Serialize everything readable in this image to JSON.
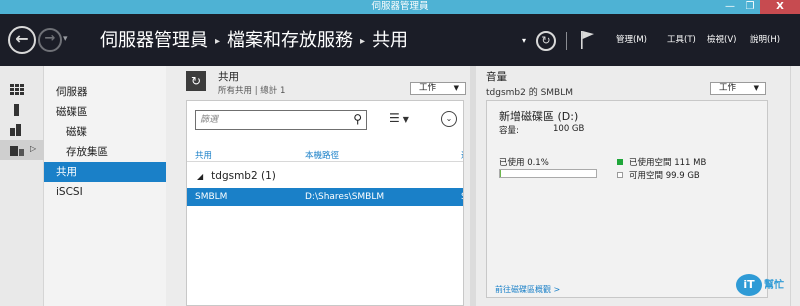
{
  "window": {
    "title": "伺服器管理員",
    "minimize_glyph": "—",
    "maximize_glyph": "❐",
    "close_glyph": "X"
  },
  "header": {
    "breadcrumb": [
      "伺服器管理員",
      "檔案和存放服務",
      "共用"
    ],
    "breadcrumb_sep": "▸",
    "menus": [
      "管理(M)",
      "工具(T)",
      "檢視(V)",
      "說明(H)"
    ],
    "back_glyph": "←",
    "forward_glyph": "→",
    "dropdown_glyph": "▾",
    "refresh_glyph": "↻"
  },
  "sidebar_icons": [
    "servers-icon",
    "server-icon",
    "volumes-icon",
    "storage-pools-icon"
  ],
  "nav": {
    "items": [
      "伺服器",
      "磁碟區",
      "磁碟",
      "存放集區",
      "共用",
      "iSCSI"
    ],
    "selected": "共用"
  },
  "shares_panel": {
    "title": "共用",
    "subtitle": "所有共用 | 總計 1",
    "tasks_label": "工作",
    "filter_placeholder": "篩選",
    "columns": [
      "共用",
      "本機路徑",
      "通"
    ],
    "group_label": "tdgsmb2 (1)",
    "rows": [
      {
        "share": "SMBLM",
        "path": "D:\\Shares\\SMBLM",
        "extra": "S"
      }
    ]
  },
  "volume_panel": {
    "title": "音量",
    "subtitle": "tdgsmb2 的 SMBLM",
    "tasks_label": "工作",
    "volume_name": "新增磁碟區 (D:)",
    "capacity_label": "容量:",
    "capacity_value": "100 GB",
    "used_label": "已使用 0.1%",
    "used_fraction": 0.001,
    "legend_used": "已使用空間 111 MB",
    "legend_free": "可用空間 99.9 GB",
    "link": "前往磁碟區概觀 >"
  },
  "logo": {
    "badge": "iT",
    "text": "幫忙"
  },
  "colors": {
    "titlebar": "#4eb2d4",
    "header": "#1b1d27",
    "selection": "#1a80c8",
    "used": "#1fa63a",
    "close": "#c74b50"
  }
}
